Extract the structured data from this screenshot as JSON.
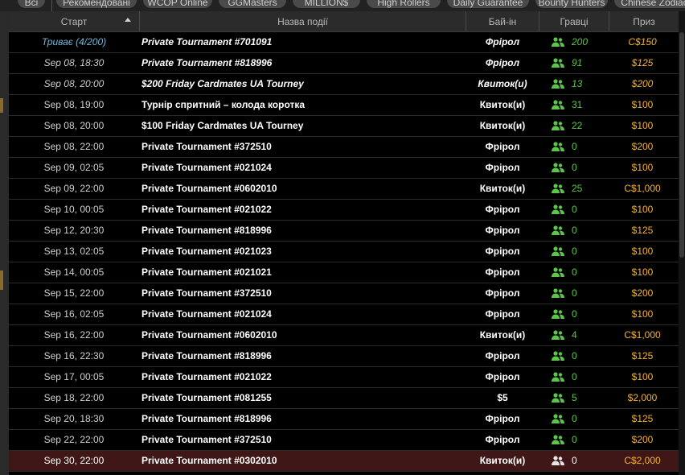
{
  "filters": [
    "Всі",
    "Рекомендовані",
    "WCOP Online",
    "GGMasters",
    "MILLION$",
    "High Rollers",
    "Daily Guarantee",
    "Bounty Hunters",
    "Chinese Zodiac"
  ],
  "table": {
    "headers": {
      "start": "Старт",
      "name": "Назва події",
      "buyin": "Бай-ін",
      "players": "Гравці",
      "prize": "Приз"
    },
    "rows": [
      {
        "start": "Триває (4/200)",
        "name": "Private Tournament #701091",
        "buyin": "Фрірол",
        "players": "200",
        "prize": "C$150"
      },
      {
        "start": "Sep 08, 18:30",
        "name": "Private Tournament #818996",
        "buyin": "Фрірол",
        "players": "91",
        "prize": "$125"
      },
      {
        "start": "Sep 08, 20:00",
        "name": "$200 Friday Cardmates UA Tourney",
        "buyin": "Квиток(и)",
        "players": "13",
        "prize": "$200"
      },
      {
        "start": "Sep 08, 19:00",
        "name": "Турнір спритний – колода коротка",
        "buyin": "Квиток(и)",
        "players": "31",
        "prize": "$100"
      },
      {
        "start": "Sep 08, 20:00",
        "name": "$100 Friday Cardmates UA Tourney",
        "buyin": "Квиток(и)",
        "players": "22",
        "prize": "$100"
      },
      {
        "start": "Sep 08, 22:00",
        "name": "Private Tournament #372510",
        "buyin": "Фрірол",
        "players": "0",
        "prize": "$200"
      },
      {
        "start": "Sep 09, 02:05",
        "name": "Private Tournament #021024",
        "buyin": "Фрірол",
        "players": "0",
        "prize": "$100"
      },
      {
        "start": "Sep 09, 22:00",
        "name": "Private Tournament #0602010",
        "buyin": "Квиток(и)",
        "players": "25",
        "prize": "C$1,000"
      },
      {
        "start": "Sep 10, 00:05",
        "name": "Private Tournament #021022",
        "buyin": "Фрірол",
        "players": "0",
        "prize": "$100"
      },
      {
        "start": "Sep 12, 20:30",
        "name": "Private Tournament #818996",
        "buyin": "Фрірол",
        "players": "0",
        "prize": "$125"
      },
      {
        "start": "Sep 13, 02:05",
        "name": "Private Tournament #021023",
        "buyin": "Фрірол",
        "players": "0",
        "prize": "$100"
      },
      {
        "start": "Sep 14, 00:05",
        "name": "Private Tournament #021021",
        "buyin": "Фрірол",
        "players": "0",
        "prize": "$100"
      },
      {
        "start": "Sep 15, 22:00",
        "name": "Private Tournament #372510",
        "buyin": "Фрірол",
        "players": "0",
        "prize": "$200"
      },
      {
        "start": "Sep 16, 02:05",
        "name": "Private Tournament #021024",
        "buyin": "Фрірол",
        "players": "0",
        "prize": "$100"
      },
      {
        "start": "Sep 16, 22:00",
        "name": "Private Tournament #0602010",
        "buyin": "Квиток(и)",
        "players": "4",
        "prize": "C$1,000"
      },
      {
        "start": "Sep 16, 22:30",
        "name": "Private Tournament #818996",
        "buyin": "Фрірол",
        "players": "0",
        "prize": "$125"
      },
      {
        "start": "Sep 17, 00:05",
        "name": "Private Tournament #021022",
        "buyin": "Фрірол",
        "players": "0",
        "prize": "$100"
      },
      {
        "start": "Sep 18, 22:00",
        "name": "Private Tournament #081255",
        "buyin": "$5",
        "players": "5",
        "prize": "$2,000"
      },
      {
        "start": "Sep 20, 18:30",
        "name": "Private Tournament #818996",
        "buyin": "Фрірол",
        "players": "0",
        "prize": "$125"
      },
      {
        "start": "Sep 22, 22:00",
        "name": "Private Tournament #372510",
        "buyin": "Фрірол",
        "players": "0",
        "prize": "$200"
      },
      {
        "start": "Sep 30, 22:00",
        "name": "Private Tournament #0302010",
        "buyin": "Квиток(и)",
        "players": "0",
        "prize": "C$2,000"
      }
    ]
  },
  "colors": {
    "running": "#6fb7d9",
    "players": "#5cc64a",
    "prize": "#f2b233",
    "selected_row": "#3f1717"
  }
}
